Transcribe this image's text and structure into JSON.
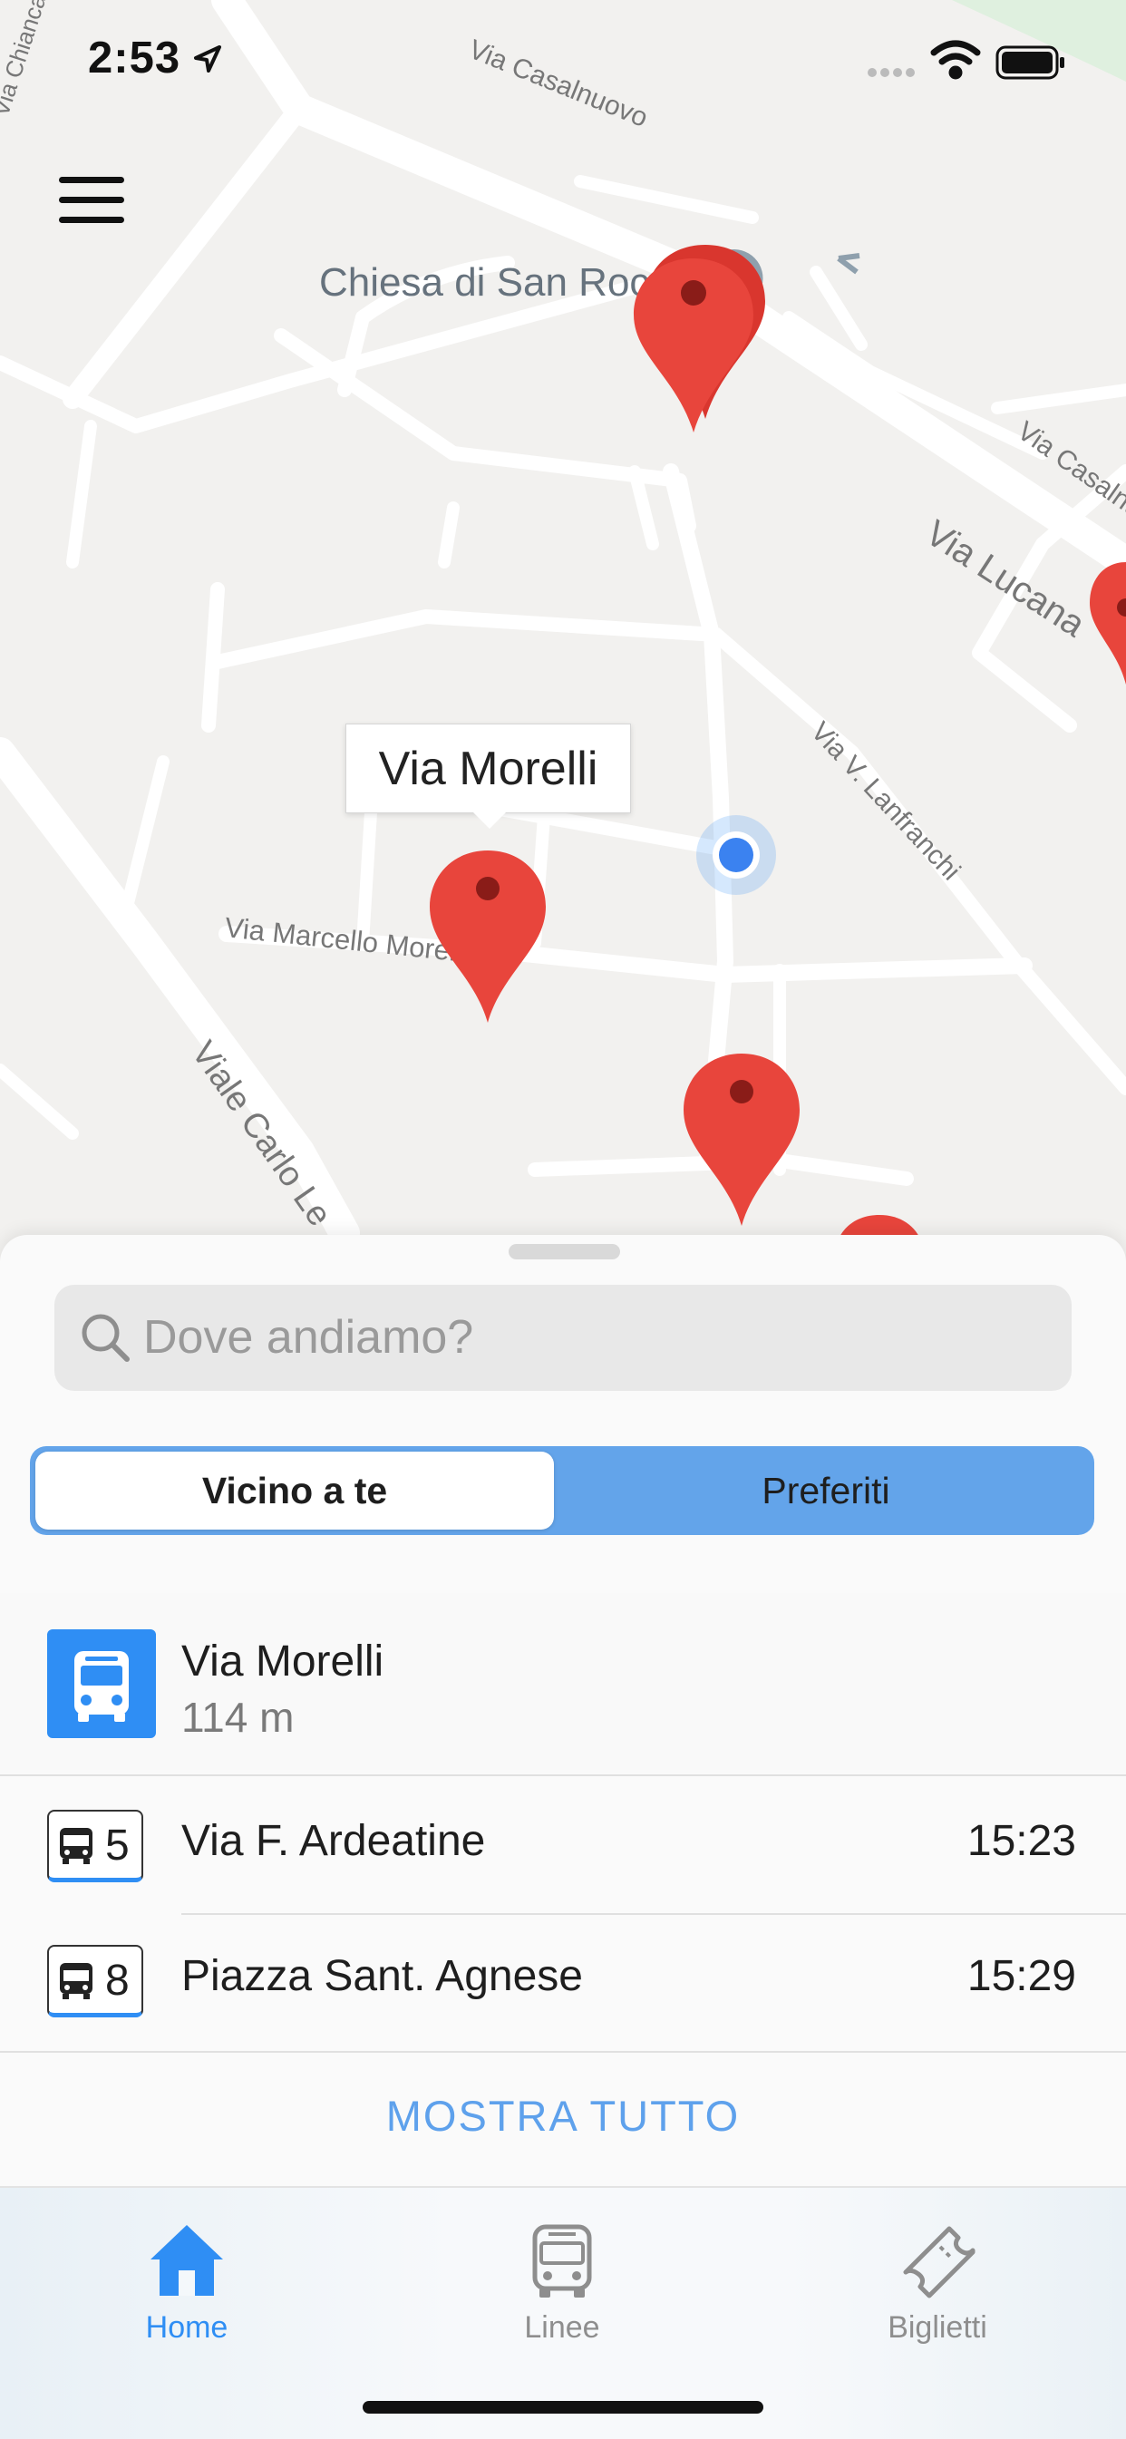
{
  "status_bar": {
    "time": "2:53"
  },
  "map": {
    "labels": {
      "church": "Chiesa di San Rocco",
      "via_casalnuovo_top": "Via Casalnuovo",
      "via_casalnuovo_right": "Via Casalnu",
      "via_lucana": "Via Lucana",
      "via_lanfranchi": "Via V. Lanfranchi",
      "via_marcello_morelli": "Via Marcello Morelli",
      "viale_carlo": "Viale Carlo Le",
      "via_chianca": "Via Chianca"
    },
    "callout": "Via Morelli"
  },
  "sheet": {
    "search_placeholder": "Dove andiamo?",
    "segments": {
      "left": "Vicino a te",
      "right": "Preferiti"
    },
    "selected_segment": "Vicino a te",
    "stop": {
      "name": "Via Morelli",
      "distance": "114 m"
    },
    "lines": [
      {
        "number": "5",
        "destination": "Via F. Ardeatine",
        "time": "15:23"
      },
      {
        "number": "8",
        "destination": "Piazza Sant. Agnese",
        "time": "15:29"
      }
    ],
    "show_all": "MOSTRA TUTTO"
  },
  "tabbar": {
    "items": [
      {
        "label": "Home",
        "icon": "home-icon",
        "active": true
      },
      {
        "label": "Linee",
        "icon": "bus-icon",
        "active": false
      },
      {
        "label": "Biglietti",
        "icon": "ticket-icon",
        "active": false
      }
    ]
  },
  "colors": {
    "accent": "#2f8ef4",
    "segment_bg": "#63a4ea",
    "show_all": "#5ea1ec",
    "pin": "#e8453c",
    "tab_inactive": "#8e8e8e"
  }
}
